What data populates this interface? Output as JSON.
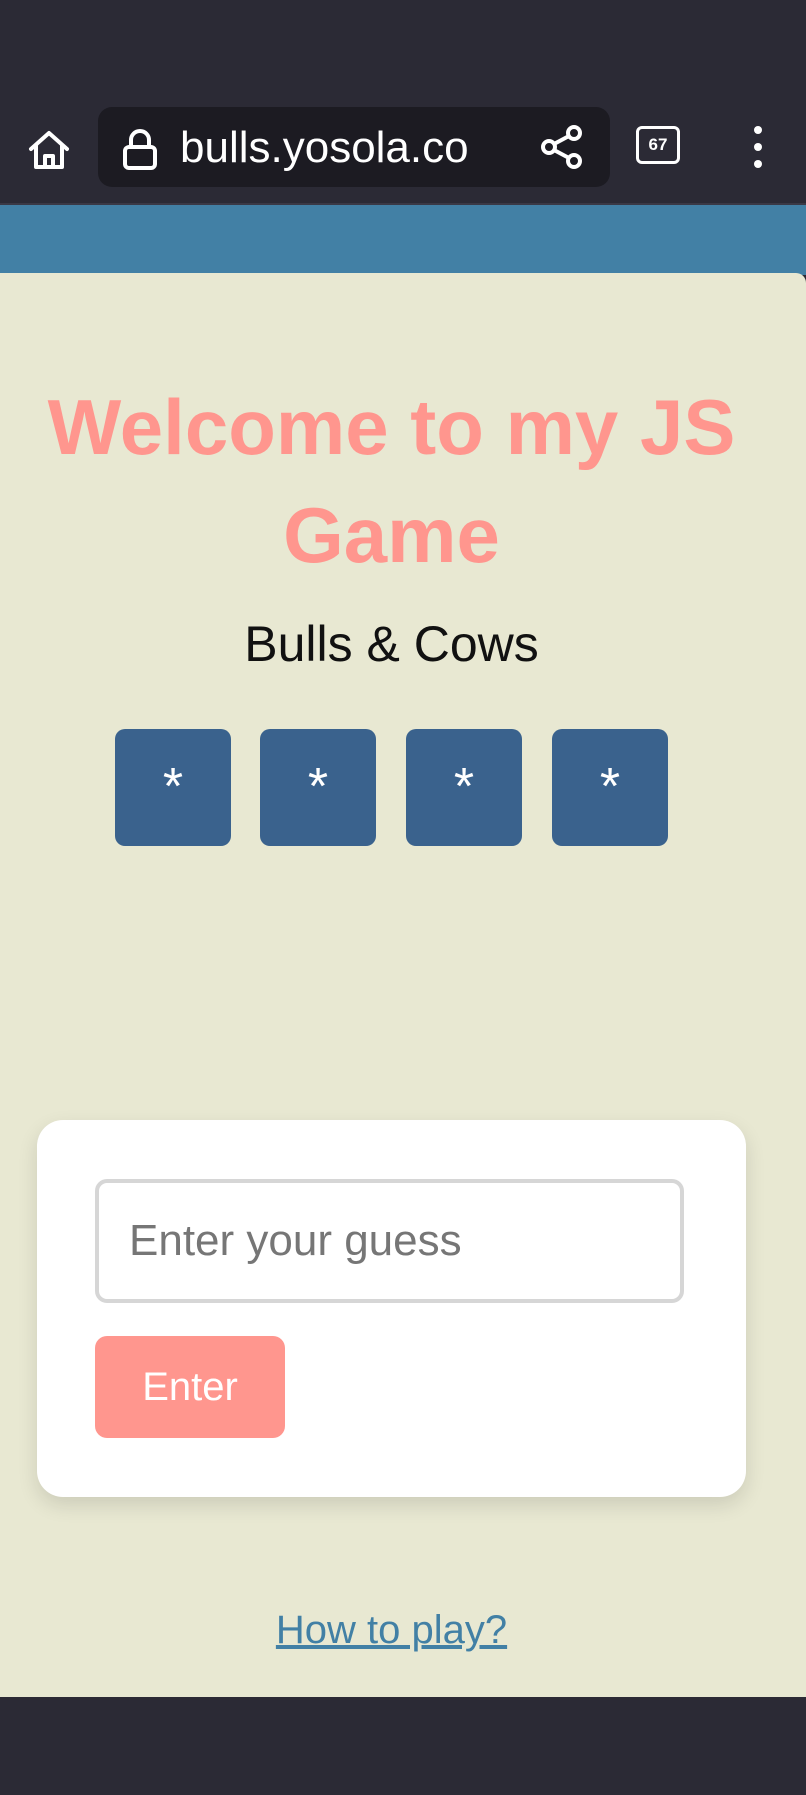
{
  "browser": {
    "url": "bulls.yosola.co",
    "tab_count": "67",
    "icons": [
      "home-icon",
      "lock-icon",
      "share-icon",
      "tabs-icon",
      "menu-icon"
    ]
  },
  "page": {
    "title": "Welcome to my JS Game",
    "subtitle": "Bulls & Cows",
    "secret_digits": [
      "*",
      "*",
      "*",
      "*"
    ],
    "guess_input": {
      "placeholder": "Enter your guess",
      "value": ""
    },
    "enter_label": "Enter",
    "how_to_play_label": "How to play?"
  },
  "colors": {
    "browser_chrome": "#2b2a35",
    "accent_blue": "#4280a5",
    "background": "#e8e8d2",
    "title_pink": "#ff968e",
    "digit_box": "#3a628d"
  }
}
